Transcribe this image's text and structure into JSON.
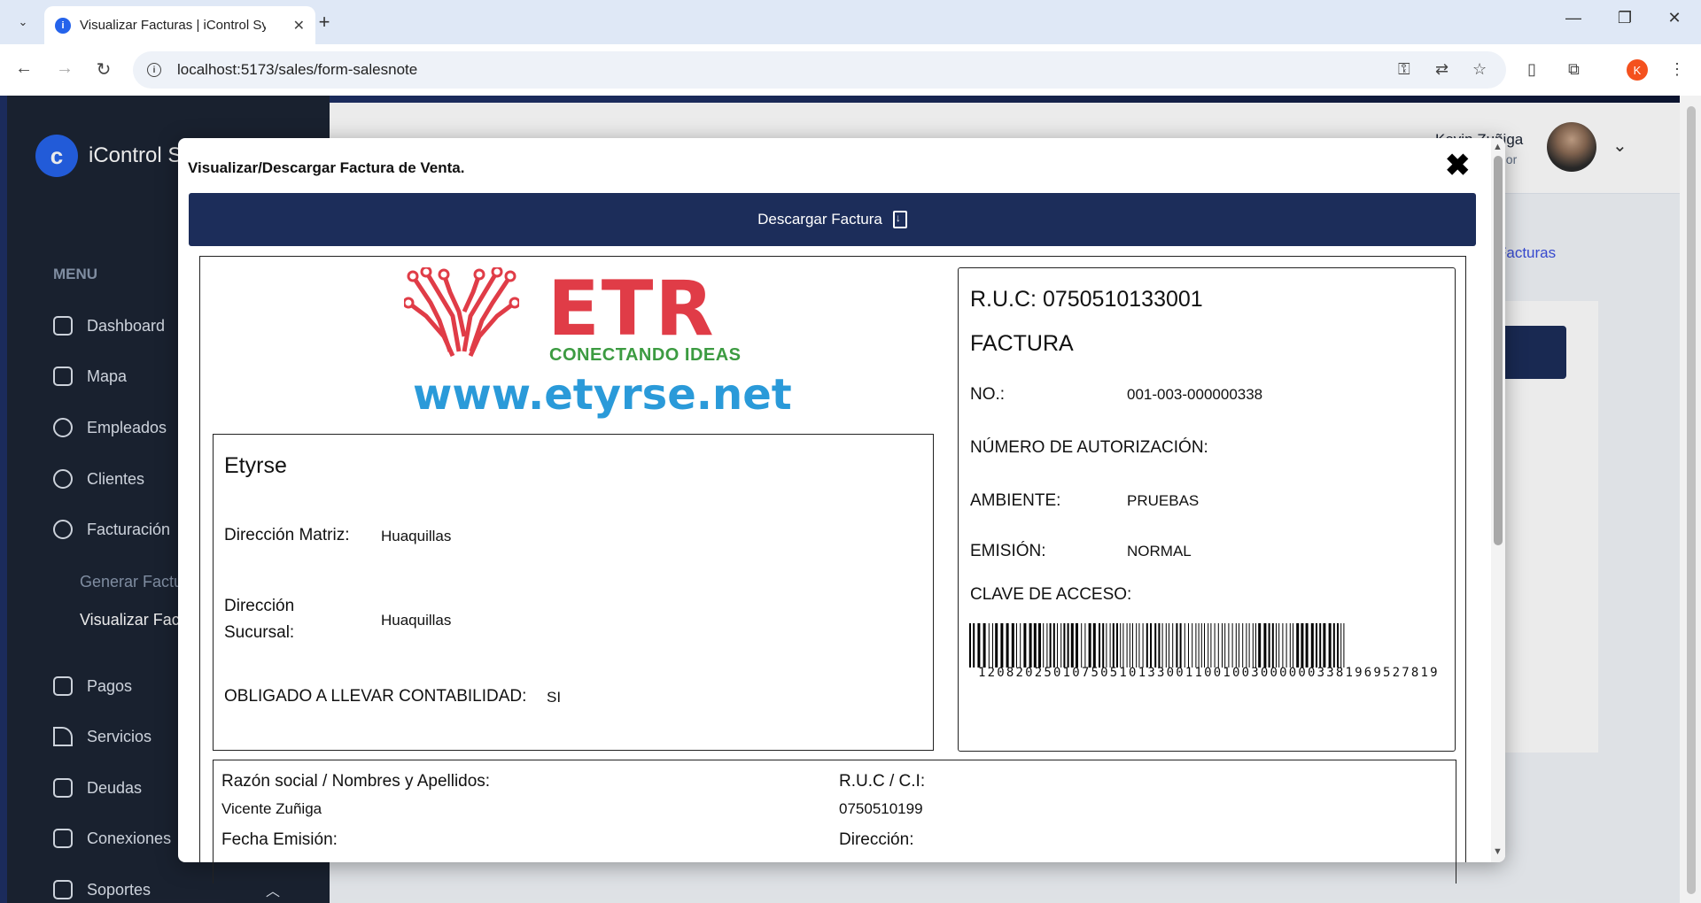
{
  "browser": {
    "tab_title": "Visualizar Facturas | iControl Sys",
    "url": "localhost:5173/sales/form-salesnote",
    "profile_initial": "K"
  },
  "app": {
    "logo_text": "iControl S",
    "menu_title": "MENU",
    "sidebar": {
      "items": [
        {
          "label": "Dashboard",
          "icon": "grid-icon"
        },
        {
          "label": "Mapa",
          "icon": "map-icon"
        },
        {
          "label": "Empleados",
          "icon": "user-icon"
        },
        {
          "label": "Clientes",
          "icon": "users-icon"
        },
        {
          "label": "Facturación",
          "icon": "dollar-icon"
        },
        {
          "label": "Pagos",
          "icon": "card-icon"
        },
        {
          "label": "Servicios",
          "icon": "rss-icon"
        },
        {
          "label": "Deudas",
          "icon": "money-icon"
        },
        {
          "label": "Conexiones",
          "icon": "server-icon"
        },
        {
          "label": "Soportes",
          "icon": "ticket-icon"
        }
      ],
      "subitems": [
        "Generar Factu",
        "Visualizar Fact"
      ]
    },
    "header": {
      "user_name": "Kevin Zuñiga",
      "user_role": "dor"
    },
    "breadcrumb": "Facturas"
  },
  "modal": {
    "title": "Visualizar/Descargar Factura de Venta.",
    "download_label": "Descargar Factura",
    "logo": {
      "brand": "ETR",
      "slogan": "CONECTANDO IDEAS",
      "url": "www.etyrse.net"
    },
    "issuer": {
      "name": "Etyrse",
      "matriz_label": "Dirección Matriz:",
      "matriz_value": "Huaquillas",
      "sucursal_label_1": "Dirección",
      "sucursal_label_2": "Sucursal:",
      "sucursal_value": "Huaquillas",
      "contabilidad_label": "OBLIGADO A LLEVAR CONTABILIDAD:",
      "contabilidad_value": "SI"
    },
    "document": {
      "ruc": "R.U.C: 0750510133001",
      "type": "FACTURA",
      "no_label": "NO.:",
      "no_value": "001-003-000000338",
      "autorizacion_label": "NÚMERO DE AUTORIZACIÓN:",
      "ambiente_label": "AMBIENTE:",
      "ambiente_value": "PRUEBAS",
      "emision_label": "EMISIÓN:",
      "emision_value": "NORMAL",
      "clave_label": "CLAVE DE ACCESO:",
      "clave_value": "1208202501075051013300110010030000003381969527819"
    },
    "client": {
      "razon_label": "Razón social / Nombres y Apellidos:",
      "razon_value": "Vicente Zuñiga",
      "ruc_label": "R.U.C / C.I:",
      "ruc_value": "0750510199",
      "fecha_label": "Fecha Emisión:",
      "direccion_label": "Dirección:"
    }
  }
}
